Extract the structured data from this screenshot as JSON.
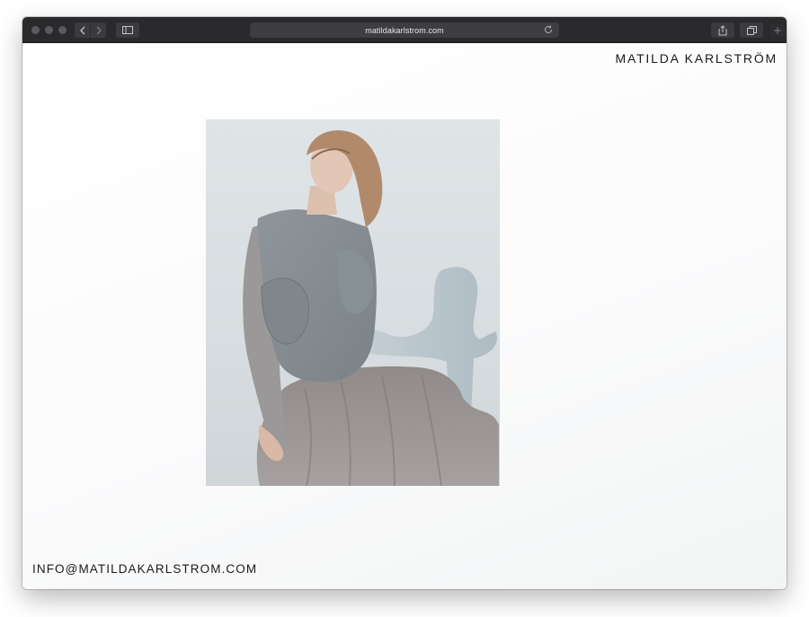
{
  "browser": {
    "url": "matildakarlstrom.com"
  },
  "site": {
    "title": "MATILDA KARLSTRÖM",
    "contact_email": "INFO@MATILDAKARLSTROM.COM"
  },
  "colors": {
    "toolbar": "#2a2a2c",
    "page_background": "#fefefe",
    "text": "#1a1a1a"
  }
}
